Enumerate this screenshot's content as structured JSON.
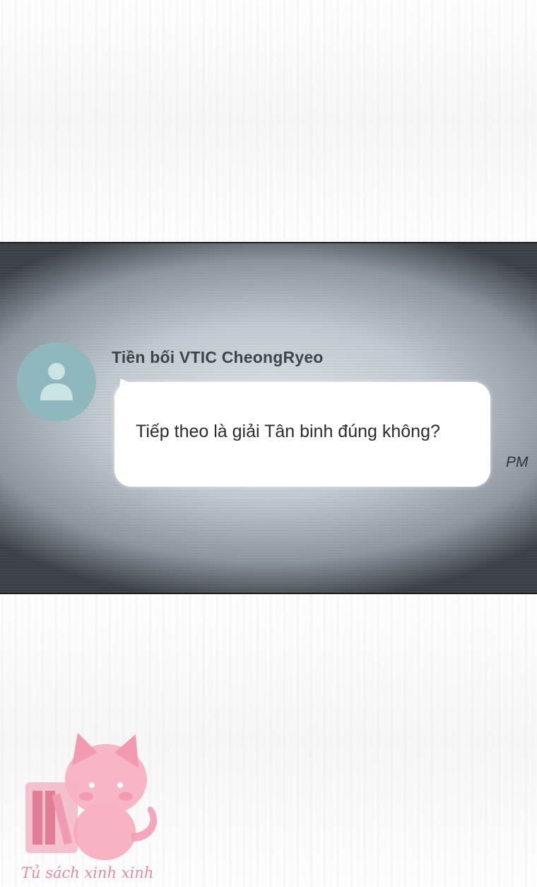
{
  "message": {
    "sender": "Tiền bối VTIC CheongRyeo",
    "text": "Tiếp theo là giải Tân binh đúng không?",
    "time": "PM",
    "avatar_icon": "user-icon"
  },
  "watermark": {
    "text": "Tủ sách xinh xinh",
    "icon": "cat-books-logo"
  },
  "colors": {
    "avatar": "#8fb7be",
    "bubble": "#ffffff",
    "watermark": "#e58aa2"
  }
}
